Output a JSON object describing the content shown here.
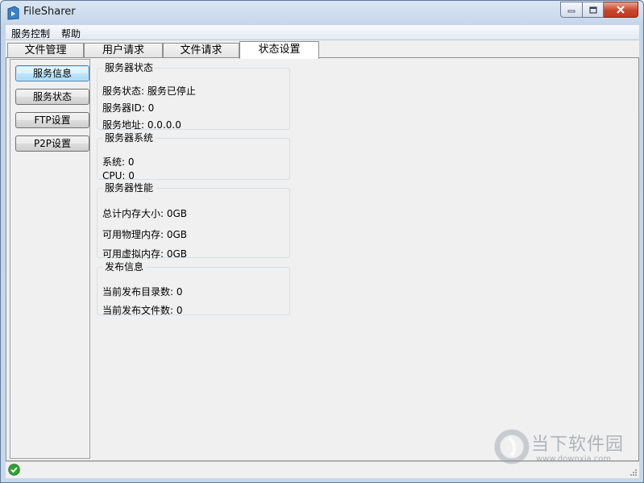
{
  "window": {
    "title": "FileSharer"
  },
  "menu": {
    "items": [
      "服务控制",
      "帮助"
    ]
  },
  "tabs": [
    {
      "label": "文件管理"
    },
    {
      "label": "用户请求"
    },
    {
      "label": "文件请求"
    },
    {
      "label": "状态设置",
      "active": true
    }
  ],
  "side_buttons": [
    {
      "label": "服务信息",
      "active": true
    },
    {
      "label": "服务状态"
    },
    {
      "label": "FTP设置"
    },
    {
      "label": "P2P设置"
    }
  ],
  "groups": {
    "server_status": {
      "title": "服务器状态",
      "state": "服务状态:  服务已停止",
      "id": "服务器ID:  0",
      "address": "服务地址:  0.0.0.0"
    },
    "server_system": {
      "title": "服务器系统",
      "system": "系统:  0",
      "cpu": "CPU:  0"
    },
    "server_performance": {
      "title": "服务器性能",
      "total_memory": "总计内存大小:  0GB",
      "physical_memory": "可用物理内存:  0GB",
      "virtual_memory": "可用虚拟内存:  0GB"
    },
    "publish_info": {
      "title": "发布信息",
      "dir_count": "当前发布目录数:  0",
      "file_count": "当前发布文件数:  0"
    }
  },
  "statusbar": {
    "icon": "check-circle-icon",
    "icon_color": "#2fa32f"
  },
  "watermark": {
    "name": "当下软件园",
    "url": "www.downxia.com"
  },
  "colors": {
    "accent": "#3c7fb1",
    "close_button": "#c9452c"
  }
}
